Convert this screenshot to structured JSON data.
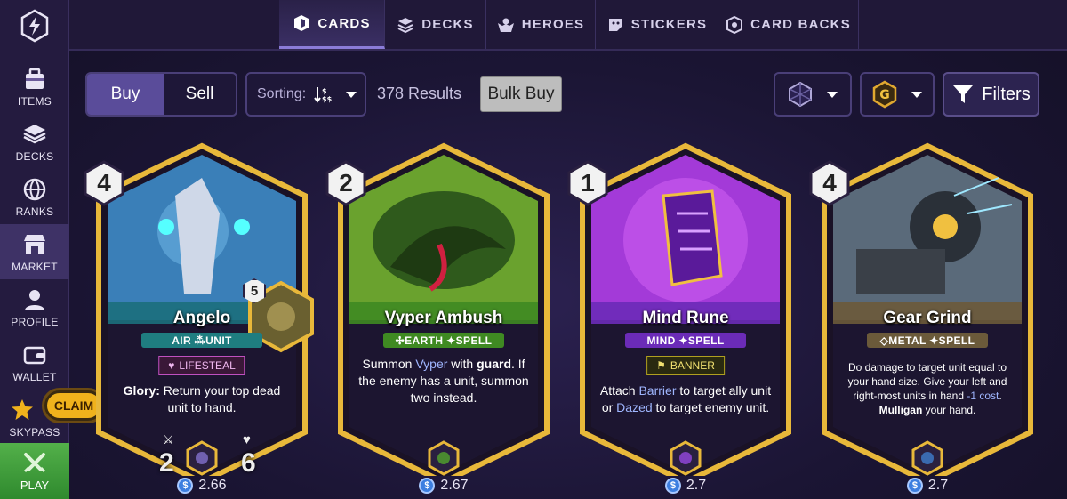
{
  "sidebar": {
    "items": [
      {
        "label": "ITEMS",
        "icon": "items-icon"
      },
      {
        "label": "DECKS",
        "icon": "decks-icon"
      },
      {
        "label": "RANKS",
        "icon": "ranks-icon"
      },
      {
        "label": "MARKET",
        "icon": "market-icon"
      },
      {
        "label": "PROFILE",
        "icon": "profile-icon"
      },
      {
        "label": "WALLET",
        "icon": "wallet-icon"
      },
      {
        "label": "SKYPASS",
        "icon": "star-icon"
      }
    ],
    "claim_label": "CLAIM",
    "play_label": "PLAY",
    "active": "MARKET"
  },
  "tabs": [
    {
      "label": "CARDS",
      "icon": "cards-icon"
    },
    {
      "label": "DECKS",
      "icon": "decks-icon"
    },
    {
      "label": "HEROES",
      "icon": "heroes-icon"
    },
    {
      "label": "STICKERS",
      "icon": "stickers-icon"
    },
    {
      "label": "CARD BACKS",
      "icon": "card-backs-icon"
    }
  ],
  "toolbar": {
    "buy_label": "Buy",
    "sell_label": "Sell",
    "sorting_label": "Sorting:",
    "results_text": "378 Results",
    "bulk_buy_label": "Bulk Buy",
    "filters_label": "Filters",
    "gold_letter": "G"
  },
  "cards": [
    {
      "cost": "4",
      "name": "Angelo",
      "type_line": "AIR ⁂UNIT",
      "keyword": "LIFESTEAL",
      "desc_bold": "Glory:",
      "desc_rest": " Return your top dead unit to hand.",
      "attack": "2",
      "health": "6",
      "hero_level": "5",
      "price": "2.66",
      "colors": {
        "frame": "#d9a62c",
        "band": "#1c6f7c",
        "art": "#3a7fb8"
      }
    },
    {
      "cost": "2",
      "name": "Vyper Ambush",
      "type_line": "✢EARTH ✦SPELL",
      "desc_pre": "Summon ",
      "desc_hl": "Vyper",
      "desc_mid": " with ",
      "desc_bold": "guard",
      "desc_post": ". If the enemy has a unit, summon two instead.",
      "price": "2.67",
      "colors": {
        "frame": "#d9a62c",
        "band": "#3f8a22",
        "art": "#6aa22e"
      }
    },
    {
      "cost": "1",
      "name": "Mind Rune",
      "type_line": "MIND ✦SPELL",
      "keyword": "BANNER",
      "desc_pre": "Attach ",
      "desc_hl": "Barrier",
      "desc_mid": " to target ally unit or ",
      "desc_hl2": "Dazed",
      "desc_post": " to target enemy unit.",
      "price": "2.7",
      "colors": {
        "frame": "#d9a62c",
        "band": "#6b2bb8",
        "art": "#a33ad8"
      }
    },
    {
      "cost": "4",
      "name": "Gear Grind",
      "type_line": "◇METAL ✦SPELL",
      "desc_pre": "Do damage to target unit equal to your hand size. Give your left and right-most units in hand ",
      "desc_hl": "-1 cost",
      "desc_mid": ". ",
      "desc_bold": "Mulligan",
      "desc_post": " your hand.",
      "price": "2.7",
      "colors": {
        "frame": "#d9a62c",
        "band": "#6b5a3a",
        "art": "#5a6a7a"
      }
    }
  ]
}
